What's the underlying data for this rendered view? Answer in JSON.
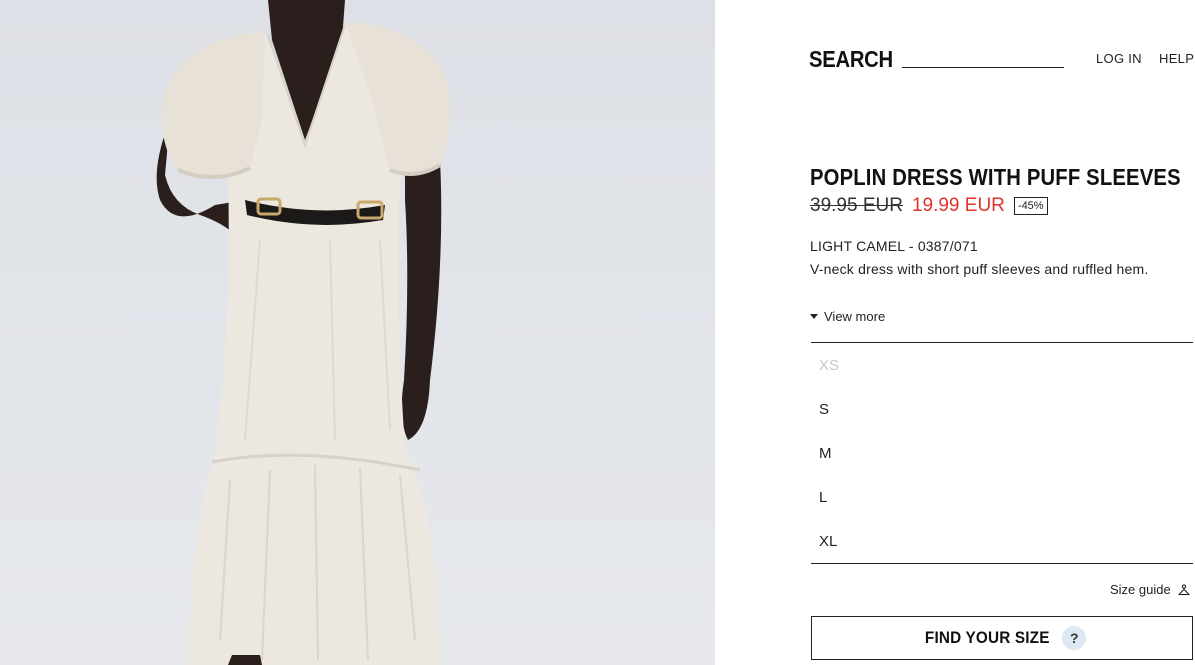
{
  "header": {
    "search_label": "SEARCH",
    "search_value": "",
    "login_label": "LOG IN",
    "help_label": "HELP"
  },
  "product": {
    "title": "POPLIN DRESS WITH PUFF SLEEVES",
    "old_price": "39.95 EUR",
    "new_price": "19.99 EUR",
    "discount": "-45%",
    "color_ref": "LIGHT CAMEL - 0387/071",
    "description": "V-neck dress with short puff sleeves and ruffled hem.",
    "view_more_label": "View more"
  },
  "sizes": [
    {
      "label": "XS",
      "available": false
    },
    {
      "label": "S",
      "available": true
    },
    {
      "label": "M",
      "available": true
    },
    {
      "label": "L",
      "available": true
    },
    {
      "label": "XL",
      "available": true
    }
  ],
  "size_guide": {
    "label": "Size guide",
    "icon": "hanger-icon"
  },
  "find_size": {
    "label": "FIND YOUR SIZE",
    "badge": "?"
  },
  "colors": {
    "sale_price": "#e0342b",
    "text": "#222222",
    "help_badge_bg": "#dce8f4"
  }
}
